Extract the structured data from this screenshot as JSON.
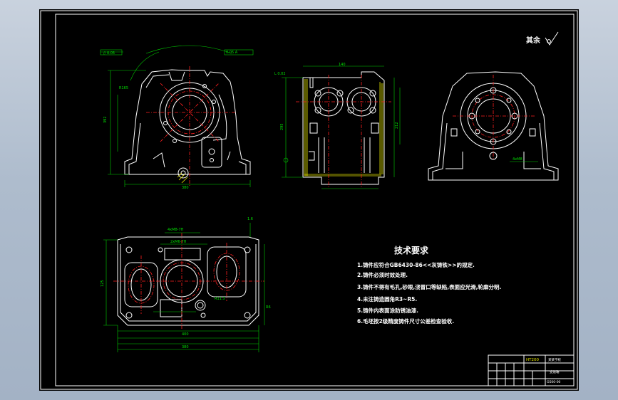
{
  "rough_mark": "其余",
  "tech_requirements": {
    "title": "技术要求",
    "items": [
      "1.铸件应符合GB6430-86<<灰铸铁>>的规定.",
      "2.铸件必须时效处理.",
      "3.铸件不得有毛孔,砂眼,浇冒口等缺陷,表面应光滑,轮廓分明.",
      "4.未注铸造圆角R3~R5.",
      "5.铸件内表面涂防锈油漆.",
      "6.毛坯按2级精度铸件尺寸公差检查验收."
    ]
  },
  "title_block": {
    "material": "HT200",
    "school": "某某学校",
    "part_name": "变速箱",
    "drawing_no": "GS00-00"
  },
  "colors": {
    "outline": "#ffffff",
    "centerline": "#ff2020",
    "dimension": "#00d000",
    "hatch": "#e0e000",
    "background": "#000000"
  }
}
